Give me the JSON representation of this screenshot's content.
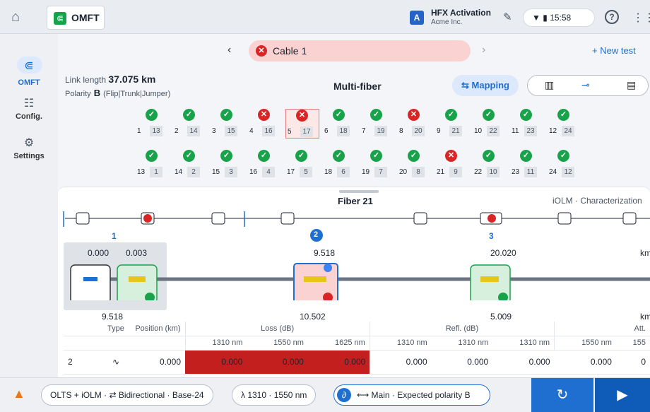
{
  "topbar": {
    "app_name": "OMFT",
    "activation_title": "HFX Activation",
    "activation_org": "Acme Inc.",
    "activation_badge": "A",
    "time": "15:58"
  },
  "sidebar": {
    "items": [
      {
        "label": "OMFT",
        "icon": "fiber-icon"
      },
      {
        "label": "Config.",
        "icon": "sliders-icon"
      },
      {
        "label": "Settings",
        "icon": "settings-icon"
      }
    ]
  },
  "cablebar": {
    "cable_label": "Cable 1",
    "new_test_label": "New test"
  },
  "link": {
    "length_label": "Link length",
    "length_value": "37.075 km",
    "polarity_label": "Polarity",
    "polarity_value": "B",
    "polarity_detail": "(Flip|Trunk|Jumper)",
    "title": "Multi-fiber",
    "mapping_label": "Mapping"
  },
  "fibers_row1": [
    {
      "n": "1",
      "m": "13",
      "ok": true
    },
    {
      "n": "2",
      "m": "14",
      "ok": true
    },
    {
      "n": "3",
      "m": "15",
      "ok": true
    },
    {
      "n": "4",
      "m": "16",
      "ok": false
    },
    {
      "n": "5",
      "m": "17",
      "ok": false
    },
    {
      "n": "6",
      "m": "18",
      "ok": true
    },
    {
      "n": "7",
      "m": "19",
      "ok": true
    },
    {
      "n": "8",
      "m": "20",
      "ok": false
    },
    {
      "n": "9",
      "m": "21",
      "ok": true
    },
    {
      "n": "10",
      "m": "22",
      "ok": true
    },
    {
      "n": "11",
      "m": "23",
      "ok": true
    },
    {
      "n": "12",
      "m": "24",
      "ok": true
    }
  ],
  "fibers_row2": [
    {
      "n": "13",
      "m": "1",
      "ok": true
    },
    {
      "n": "14",
      "m": "2",
      "ok": true
    },
    {
      "n": "15",
      "m": "3",
      "ok": true
    },
    {
      "n": "16",
      "m": "4",
      "ok": true
    },
    {
      "n": "17",
      "m": "5",
      "ok": true
    },
    {
      "n": "18",
      "m": "6",
      "ok": true
    },
    {
      "n": "19",
      "m": "7",
      "ok": true
    },
    {
      "n": "20",
      "m": "8",
      "ok": true
    },
    {
      "n": "21",
      "m": "9",
      "ok": false
    },
    {
      "n": "22",
      "m": "10",
      "ok": true
    },
    {
      "n": "23",
      "m": "11",
      "ok": true
    },
    {
      "n": "24",
      "m": "12",
      "ok": true
    }
  ],
  "panel": {
    "fiber_title": "Fiber 21",
    "mode": "iOLM · Characterization",
    "seg1": "1",
    "seg2": "2",
    "seg3": "3",
    "pos_a": "0.000",
    "pos_b": "0.003",
    "pos_c": "9.518",
    "pos_d": "20.020",
    "unit": "km",
    "dist_a": "9.518",
    "dist_b": "10.502",
    "dist_c": "5.009"
  },
  "table": {
    "h_type": "Type",
    "h_position": "Position (km)",
    "h_loss": "Loss (dB)",
    "h_refl": "Refl. (dB)",
    "h_att": "Att.",
    "w1": "1310 nm",
    "w2": "1550 nm",
    "w3": "1625 nm",
    "w4": "1310 nm",
    "w5": "1310 nm",
    "w6": "1310 nm",
    "w7": "1550 nm",
    "w8": "155",
    "row": {
      "idx": "2",
      "position": "0.000",
      "loss1": "0.000",
      "loss2": "0.000",
      "loss3": "0.000",
      "refl1": "0.000",
      "refl2": "0.000",
      "refl3": "0.000",
      "att1": "0.000",
      "att2": "0"
    }
  },
  "footer": {
    "test_label": "OLTS + iOLM · ⇄ Bidirectional · Base-24",
    "lambda_label": "λ 1310 · 1550 nm",
    "link_label": "⟷ Main · Expected polarity B"
  }
}
